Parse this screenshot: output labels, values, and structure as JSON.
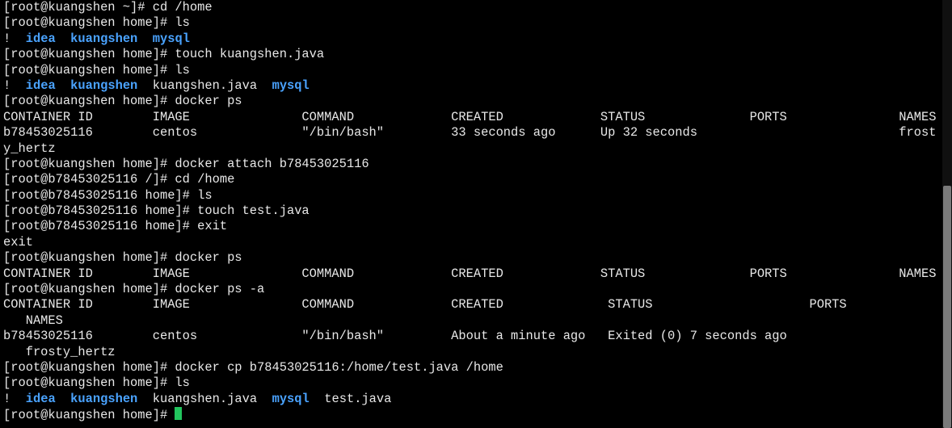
{
  "terminal": {
    "lines": [
      "[root@kuangshen ~]# cd /home",
      "[root@kuangshen home]# ls",
      {
        "type": "ls",
        "items": [
          {
            "text": "!"
          },
          {
            "text": "idea",
            "dir": true
          },
          {
            "text": "kuangshen",
            "dir": true
          },
          {
            "text": "mysql",
            "dir": true
          }
        ]
      },
      "[root@kuangshen home]# touch kuangshen.java",
      "[root@kuangshen home]# ls",
      {
        "type": "ls",
        "items": [
          {
            "text": "!"
          },
          {
            "text": "idea",
            "dir": true
          },
          {
            "text": "kuangshen",
            "dir": true
          },
          {
            "text": "kuangshen.java"
          },
          {
            "text": "mysql",
            "dir": true
          }
        ]
      },
      "[root@kuangshen home]# docker ps",
      "CONTAINER ID        IMAGE               COMMAND             CREATED             STATUS              PORTS               NAMES",
      "b78453025116        centos              \"/bin/bash\"         33 seconds ago      Up 32 seconds                           frost",
      "y_hertz",
      "[root@kuangshen home]# docker attach b78453025116",
      "[root@b78453025116 /]# cd /home",
      "[root@b78453025116 home]# ls",
      "[root@b78453025116 home]# touch test.java",
      "[root@b78453025116 home]# exit",
      "exit",
      "[root@kuangshen home]# docker ps",
      "CONTAINER ID        IMAGE               COMMAND             CREATED             STATUS              PORTS               NAMES",
      "[root@kuangshen home]# docker ps -a",
      "CONTAINER ID        IMAGE               COMMAND             CREATED              STATUS                     PORTS",
      "   NAMES",
      "b78453025116        centos              \"/bin/bash\"         About a minute ago   Exited (0) 7 seconds ago",
      "   frosty_hertz",
      "[root@kuangshen home]# docker cp b78453025116:/home/test.java /home",
      "[root@kuangshen home]# ls",
      {
        "type": "ls",
        "items": [
          {
            "text": "!"
          },
          {
            "text": "idea",
            "dir": true
          },
          {
            "text": "kuangshen",
            "dir": true
          },
          {
            "text": "kuangshen.java"
          },
          {
            "text": "mysql",
            "dir": true
          },
          {
            "text": "test.java"
          }
        ]
      },
      {
        "type": "prompt",
        "text": "[root@kuangshen home]# "
      }
    ]
  },
  "colors": {
    "background": "#000000",
    "foreground": "#e8e8e8",
    "directory": "#4aa3ff",
    "cursor": "#22c55e"
  }
}
